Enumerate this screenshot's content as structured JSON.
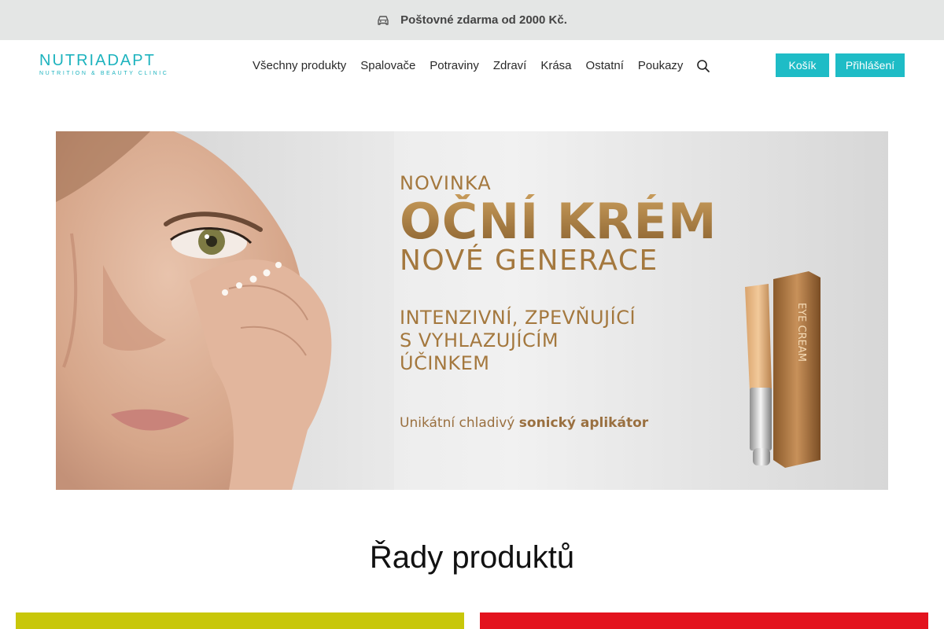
{
  "topbar": {
    "text": "Poštovné zdarma od 2000 Kč.",
    "icon": "car-icon"
  },
  "logo": {
    "main": "NUTRIADAPT",
    "sub": "NUTRITION & BEAUTY CLINIC"
  },
  "nav": {
    "items": [
      "Všechny produkty",
      "Spalovače",
      "Potraviny",
      "Zdraví",
      "Krása",
      "Ostatní",
      "Poukazy"
    ],
    "search_icon": "search-icon"
  },
  "buttons": {
    "cart": "Košík",
    "login": "Přihlášení"
  },
  "hero": {
    "kicker": "NOVINKA",
    "headline": "OČNÍ KRÉM",
    "subheadline": "NOVÉ GENERACE",
    "lines": [
      "INTENZIVNÍ, ZPEVŇUJÍCÍ",
      "S VYHLAZUJÍCÍM",
      "ÚČINKEM"
    ],
    "tag_prefix": "Unikátní chladivý ",
    "tag_bold": "sonický aplikátor",
    "product_label": "EYE CREAM"
  },
  "section": {
    "title": "Řady produktů"
  },
  "colors": {
    "accent": "#1ebcc6",
    "gold": "#a4783e",
    "tile_left": "#c8c70a",
    "tile_right": "#e3131e"
  }
}
